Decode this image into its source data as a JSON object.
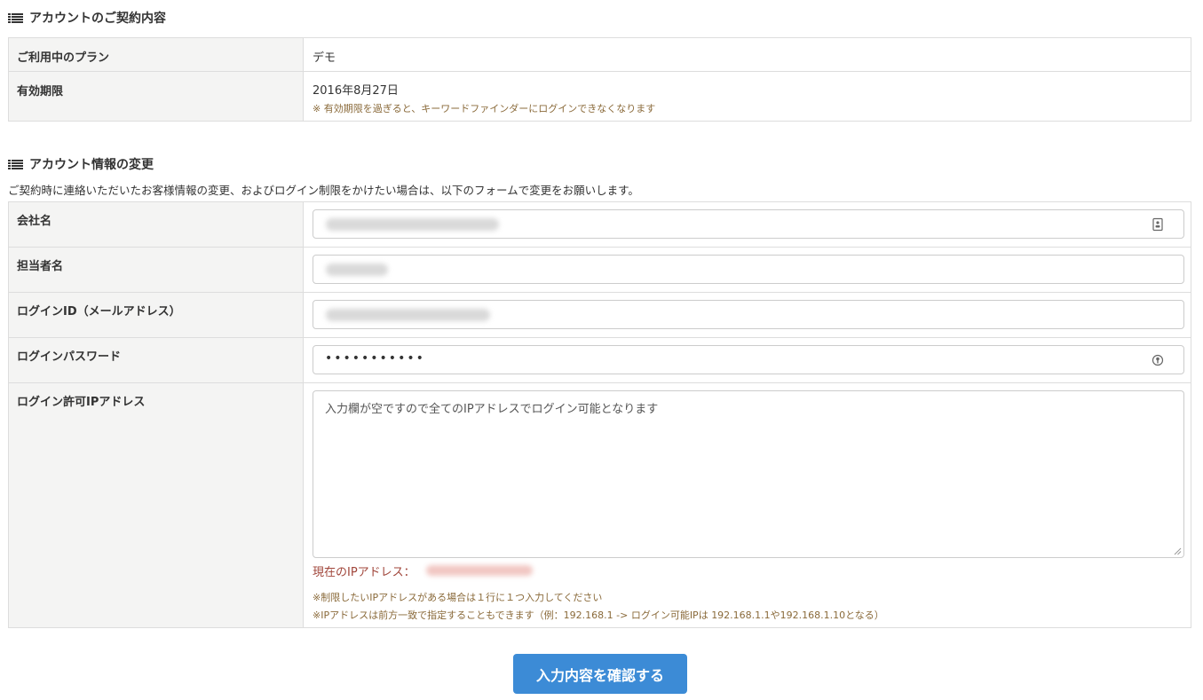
{
  "contract": {
    "heading": "アカウントのご契約内容",
    "plan_label": "ご利用中のプラン",
    "plan_value": "デモ",
    "expiry_label": "有効期限",
    "expiry_value": "2016年8月27日",
    "expiry_note": "※ 有効期限を過ぎると、キーワードファインダーにログインできなくなります"
  },
  "account": {
    "heading": "アカウント情報の変更",
    "intro": "ご契約時に連絡いただいたお客様情報の変更、およびログイン制限をかけたい場合は、以下のフォームで変更をお願いします。",
    "company_label": "会社名",
    "contact_label": "担当者名",
    "login_id_label": "ログインID（メールアドレス）",
    "password_label": "ログインパスワード",
    "password_mask": "•••••••••••",
    "ip_label": "ログイン許可IPアドレス",
    "ip_placeholder": "入力欄が空ですので全てのIPアドレスでログイン可能となります",
    "current_ip_label": "現在のIPアドレス：",
    "note1": "※制限したいIPアドレスがある場合は１行に１つ入力してください",
    "note2": "※IPアドレスは前方一致で指定することもできます（例：192.168.1 -> ログイン可能IPは 192.168.1.1や192.168.1.10となる）"
  },
  "confirm_button": "入力内容を確認する",
  "icons": {
    "heading": "list-icon",
    "company_field": "contact-card-icon",
    "password_field": "key-icon"
  },
  "colors": {
    "button": "#3c8bd6",
    "label_bg": "#f4f4f3",
    "note": "#8a6a3a",
    "current_ip": "#a0453a"
  }
}
